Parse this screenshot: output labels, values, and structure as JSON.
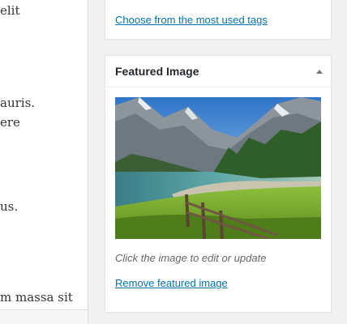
{
  "editor": {
    "lines": [
      "elit",
      "auris.",
      "ere",
      "us.",
      "m massa sit"
    ]
  },
  "tags_box": {
    "most_used_link": "Choose from the most used tags"
  },
  "featured_image": {
    "title": "Featured Image",
    "toggle_icon": "triangle-up-icon",
    "image_alt": "Mountain lake landscape with wooden fence",
    "hint": "Click the image to edit or update",
    "remove_link": "Remove featured image"
  },
  "colors": {
    "link": "#0073aa",
    "background": "#f1f1f1",
    "box_border": "#e5e5e5"
  }
}
